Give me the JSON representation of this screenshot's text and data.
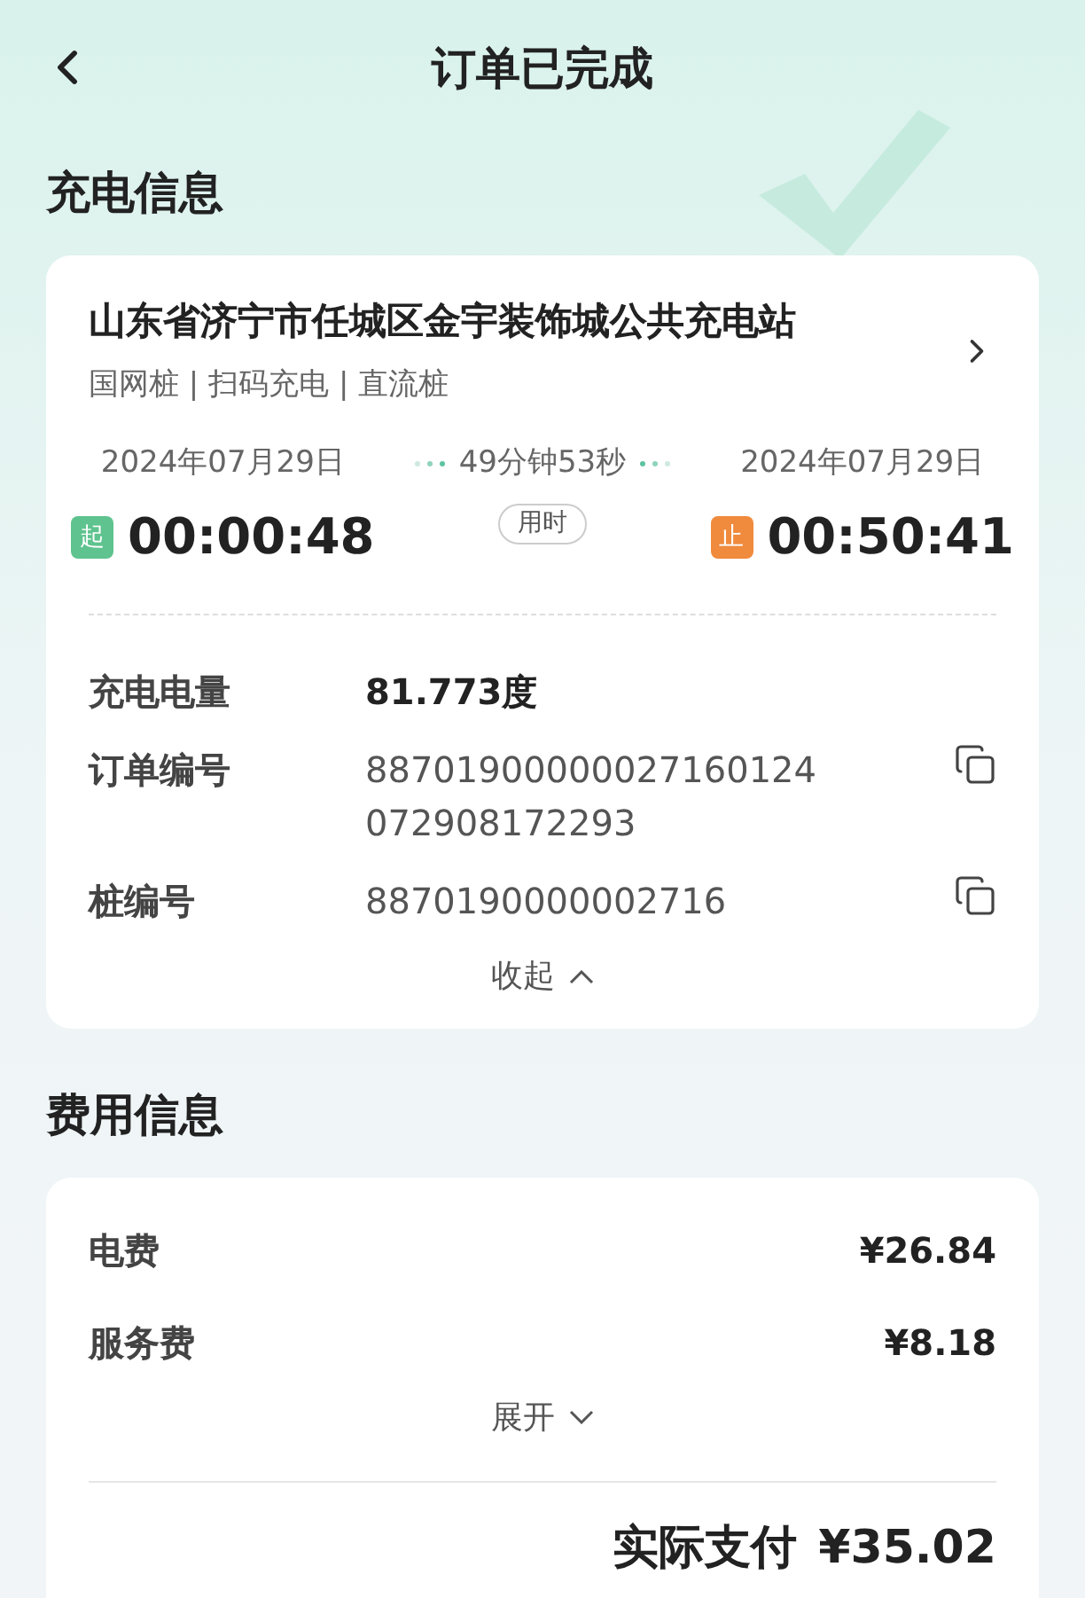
{
  "header": {
    "title": "订单已完成"
  },
  "charging": {
    "title": "充电信息",
    "station": {
      "name": "山东省济宁市任城区金宇装饰城公共充电站",
      "tags": "国网桩 | 扫码充电 | 直流桩"
    },
    "start": {
      "date": "2024年07月29日",
      "badge": "起",
      "time": "00:00:48"
    },
    "duration": {
      "text": "49分钟53秒",
      "label": "用时"
    },
    "end": {
      "date": "2024年07月29日",
      "badge": "止",
      "time": "00:50:41"
    },
    "details": [
      {
        "label": "充电电量",
        "value": "81.773度",
        "kind": "plain"
      },
      {
        "label": "订单编号",
        "value": "88701900000027160124072908172293",
        "kind": "copy"
      },
      {
        "label": "桩编号",
        "value": "8870190000002716",
        "kind": "copy"
      }
    ],
    "toggle": {
      "label": "收起",
      "expanded": true
    }
  },
  "fees": {
    "title": "费用信息",
    "items": [
      {
        "label": "电费",
        "value": "¥26.84"
      },
      {
        "label": "服务费",
        "value": "¥8.18"
      }
    ],
    "toggle": {
      "label": "展开",
      "expanded": false
    },
    "total": {
      "label": "实际支付",
      "value": "¥35.02"
    }
  }
}
